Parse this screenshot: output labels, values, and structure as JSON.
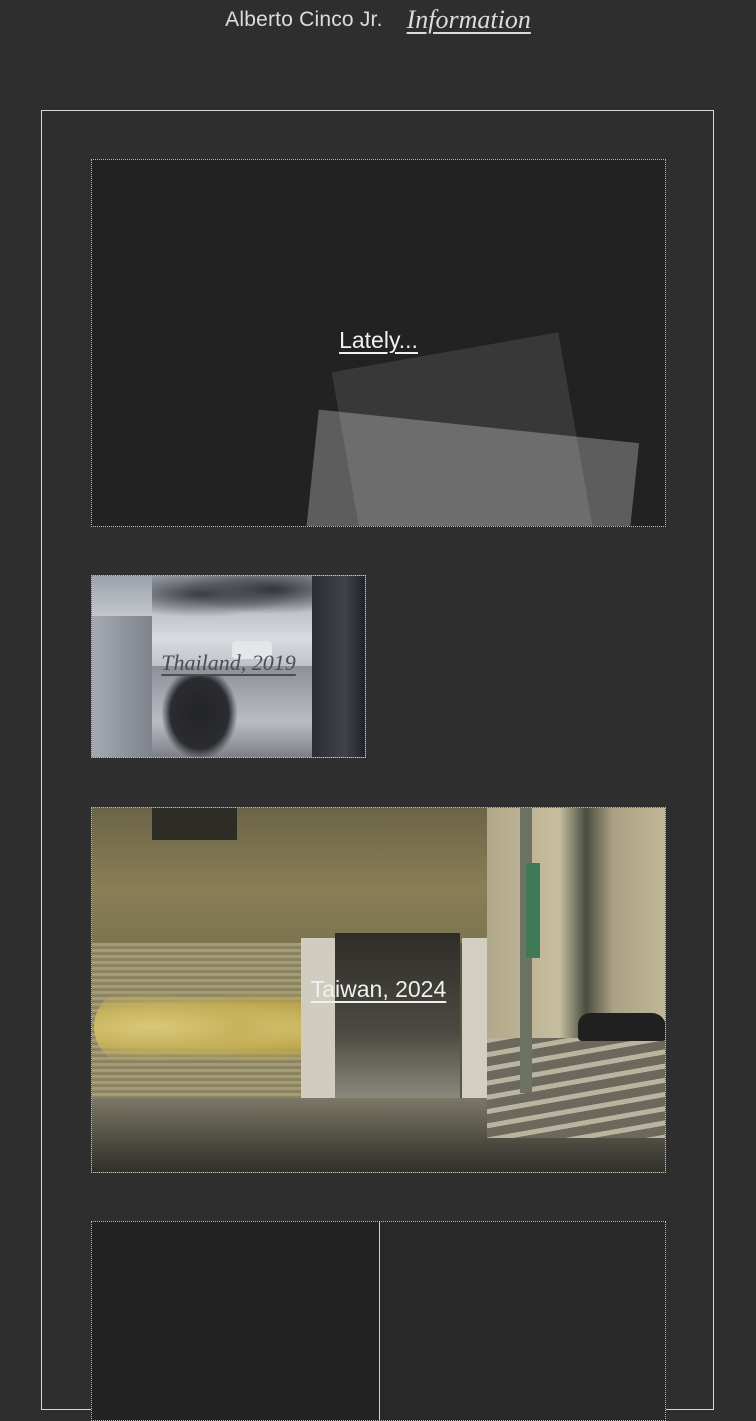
{
  "header": {
    "site_name": "Alberto Cinco Jr.",
    "info_link": "Information"
  },
  "cards": [
    {
      "label": "Lately..."
    },
    {
      "label": "Thailand, 2019"
    },
    {
      "label": "Taiwan, 2024"
    }
  ],
  "colors": {
    "background": "#2e2e2e",
    "frame_border": "#d8d8d8",
    "text": "#e8e8e8"
  }
}
